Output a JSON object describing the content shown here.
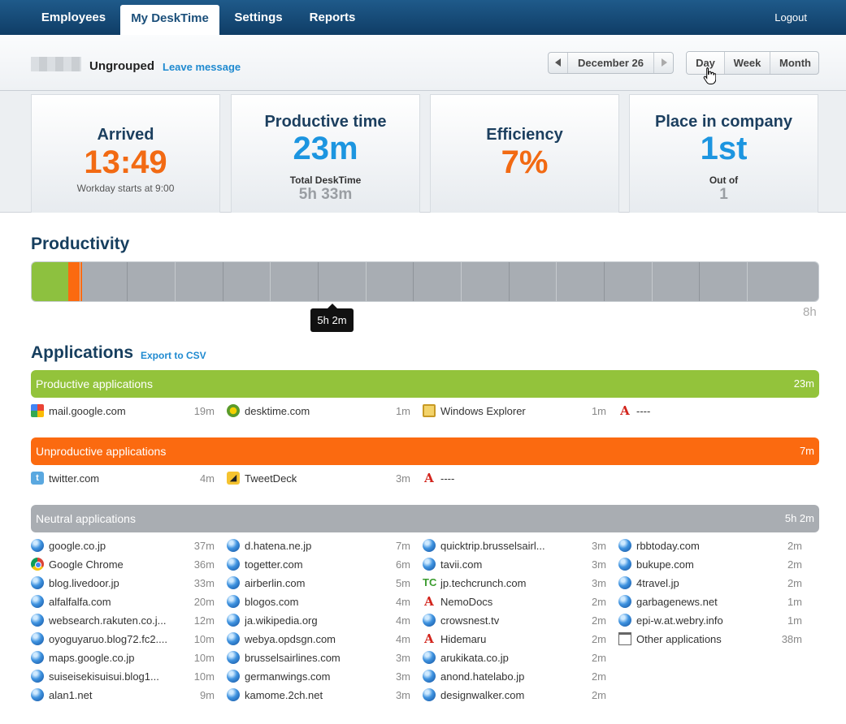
{
  "nav": {
    "tabs": [
      "Employees",
      "My DeskTime",
      "Settings",
      "Reports"
    ],
    "active": "My DeskTime",
    "logout": "Logout"
  },
  "subheader": {
    "group": "Ungrouped",
    "leave_message": "Leave message",
    "date": "December 26",
    "periods": [
      "Day",
      "Week",
      "Month"
    ],
    "active_period": "Day"
  },
  "stats": {
    "arrived": {
      "title": "Arrived",
      "value": "13:49",
      "note": "Workday starts at 9:00"
    },
    "productive": {
      "title": "Productive time",
      "value": "23m",
      "sub_label": "Total DeskTime",
      "sub_value": "5h 33m"
    },
    "efficiency": {
      "title": "Efficiency",
      "value": "7%"
    },
    "place": {
      "title": "Place in company",
      "value": "1st",
      "sub_label": "Out of",
      "sub_value": "1"
    }
  },
  "productivity": {
    "title": "Productivity",
    "tooltip": "5h 2m",
    "max_label": "8h",
    "productive_fraction": 0.047,
    "unproductive_fraction": 0.017,
    "neutral_fraction": 0.63,
    "colors": {
      "productive": "#8dc13f",
      "unproductive": "#fb6a10",
      "neutral": "#a8adb3"
    }
  },
  "applications": {
    "title": "Applications",
    "export": "Export to CSV",
    "categories": [
      {
        "label": "Productive applications",
        "total": "23m",
        "color": "#93c33b",
        "apps": [
          {
            "name": "mail.google.com",
            "time": "19m",
            "icon": "google-icon"
          },
          {
            "name": "desktime.com",
            "time": "1m",
            "icon": "desktime-icon"
          },
          {
            "name": "Windows Explorer",
            "time": "1m",
            "icon": "windows-explorer-icon"
          },
          {
            "name": "----",
            "time": "",
            "icon": "acrobat-icon"
          }
        ]
      },
      {
        "label": "Unproductive applications",
        "total": "7m",
        "color": "#fb6a10",
        "apps": [
          {
            "name": "twitter.com",
            "time": "4m",
            "icon": "twitter-icon"
          },
          {
            "name": "TweetDeck",
            "time": "3m",
            "icon": "tweetdeck-icon"
          },
          {
            "name": "----",
            "time": "",
            "icon": "acrobat-icon"
          }
        ]
      },
      {
        "label": "Neutral applications",
        "total": "5h 2m",
        "color": "#a9adb2",
        "apps": [
          {
            "name": "google.co.jp",
            "time": "37m",
            "icon": "globe-icon"
          },
          {
            "name": "Google Chrome",
            "time": "36m",
            "icon": "chrome-icon"
          },
          {
            "name": "blog.livedoor.jp",
            "time": "33m",
            "icon": "globe-icon"
          },
          {
            "name": "alfalfalfa.com",
            "time": "20m",
            "icon": "globe-icon"
          },
          {
            "name": "websearch.rakuten.co.j...",
            "time": "12m",
            "icon": "globe-icon"
          },
          {
            "name": "oyoguyaruo.blog72.fc2....",
            "time": "10m",
            "icon": "globe-icon"
          },
          {
            "name": "maps.google.co.jp",
            "time": "10m",
            "icon": "globe-icon"
          },
          {
            "name": "suiseisekisuisui.blog1...",
            "time": "10m",
            "icon": "globe-icon"
          },
          {
            "name": "alan1.net",
            "time": "9m",
            "icon": "globe-icon"
          },
          {
            "name": "d.hatena.ne.jp",
            "time": "7m",
            "icon": "globe-icon"
          },
          {
            "name": "togetter.com",
            "time": "6m",
            "icon": "globe-icon"
          },
          {
            "name": "airberlin.com",
            "time": "5m",
            "icon": "globe-icon"
          },
          {
            "name": "blogos.com",
            "time": "4m",
            "icon": "globe-icon"
          },
          {
            "name": "ja.wikipedia.org",
            "time": "4m",
            "icon": "globe-icon"
          },
          {
            "name": "webya.opdsgn.com",
            "time": "4m",
            "icon": "globe-icon"
          },
          {
            "name": "brusselsairlines.com",
            "time": "3m",
            "icon": "globe-icon"
          },
          {
            "name": "germanwings.com",
            "time": "3m",
            "icon": "globe-icon"
          },
          {
            "name": "kamome.2ch.net",
            "time": "3m",
            "icon": "globe-icon"
          },
          {
            "name": "quicktrip.brusselsairl...",
            "time": "3m",
            "icon": "globe-icon"
          },
          {
            "name": "tavii.com",
            "time": "3m",
            "icon": "globe-icon"
          },
          {
            "name": "jp.techcrunch.com",
            "time": "3m",
            "icon": "techcrunch-icon"
          },
          {
            "name": "NemoDocs",
            "time": "2m",
            "icon": "acrobat-icon"
          },
          {
            "name": "crowsnest.tv",
            "time": "2m",
            "icon": "globe-icon"
          },
          {
            "name": "Hidemaru",
            "time": "2m",
            "icon": "acrobat-icon"
          },
          {
            "name": "arukikata.co.jp",
            "time": "2m",
            "icon": "globe-icon"
          },
          {
            "name": "anond.hatelabo.jp",
            "time": "2m",
            "icon": "globe-icon"
          },
          {
            "name": "designwalker.com",
            "time": "2m",
            "icon": "globe-icon"
          },
          {
            "name": "rbbtoday.com",
            "time": "2m",
            "icon": "globe-icon"
          },
          {
            "name": "bukupe.com",
            "time": "2m",
            "icon": "globe-icon"
          },
          {
            "name": "4travel.jp",
            "time": "2m",
            "icon": "globe-icon"
          },
          {
            "name": "garbagenews.net",
            "time": "1m",
            "icon": "globe-icon"
          },
          {
            "name": "epi-w.at.webry.info",
            "time": "1m",
            "icon": "globe-icon"
          },
          {
            "name": "Other applications",
            "time": "38m",
            "icon": "window-icon"
          }
        ]
      }
    ]
  }
}
